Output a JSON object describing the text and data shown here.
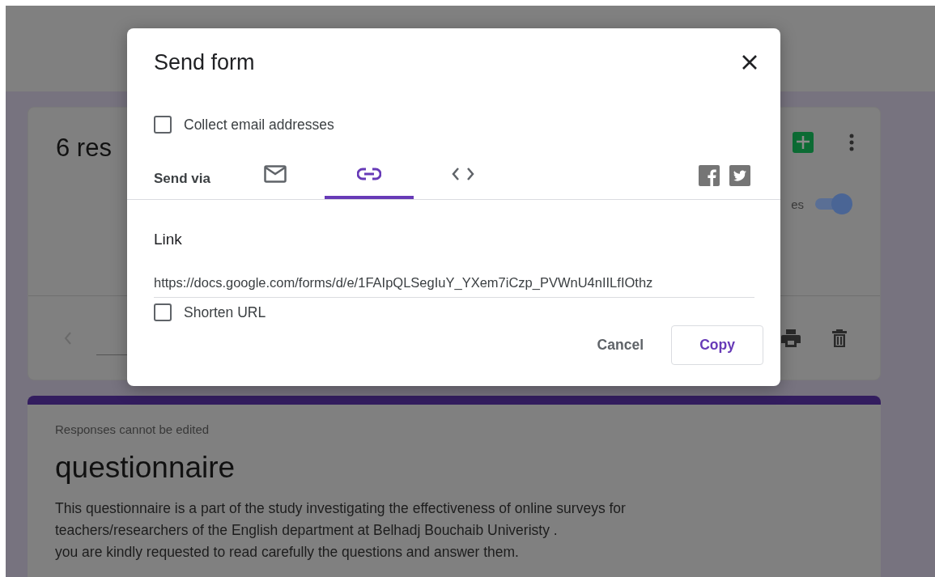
{
  "summary_card": {
    "title": "6 res",
    "accepting_label": "es",
    "accepting_toggle": {
      "on": true
    }
  },
  "form_card": {
    "notice": "Responses cannot be edited",
    "title": "questionnaire",
    "description_lines": [
      "This questionnaire is a part of the study investigating the effectiveness of online surveys for",
      "teachers/researchers of the English department at Belhadj Bouchaib Univeristy .",
      "you are kindly requested to read carefully the questions and answer them."
    ]
  },
  "dialog": {
    "title": "Send form",
    "collect_email": {
      "label": "Collect email addresses",
      "checked": false
    },
    "send_via_label": "Send via",
    "tabs": [
      {
        "kind": "email",
        "selected": false
      },
      {
        "kind": "link",
        "selected": true
      },
      {
        "kind": "embed",
        "selected": false
      }
    ],
    "section_title": "Link",
    "link_value": "https://docs.google.com/forms/d/e/1FAIpQLSegIuY_YXem7iCzp_PVWnU4nIILfIOthz",
    "shorten_url": {
      "label": "Shorten URL",
      "checked": false
    },
    "buttons": [
      {
        "label": "Cancel",
        "kind": "text"
      },
      {
        "label": "Copy",
        "kind": "outlined"
      }
    ]
  }
}
